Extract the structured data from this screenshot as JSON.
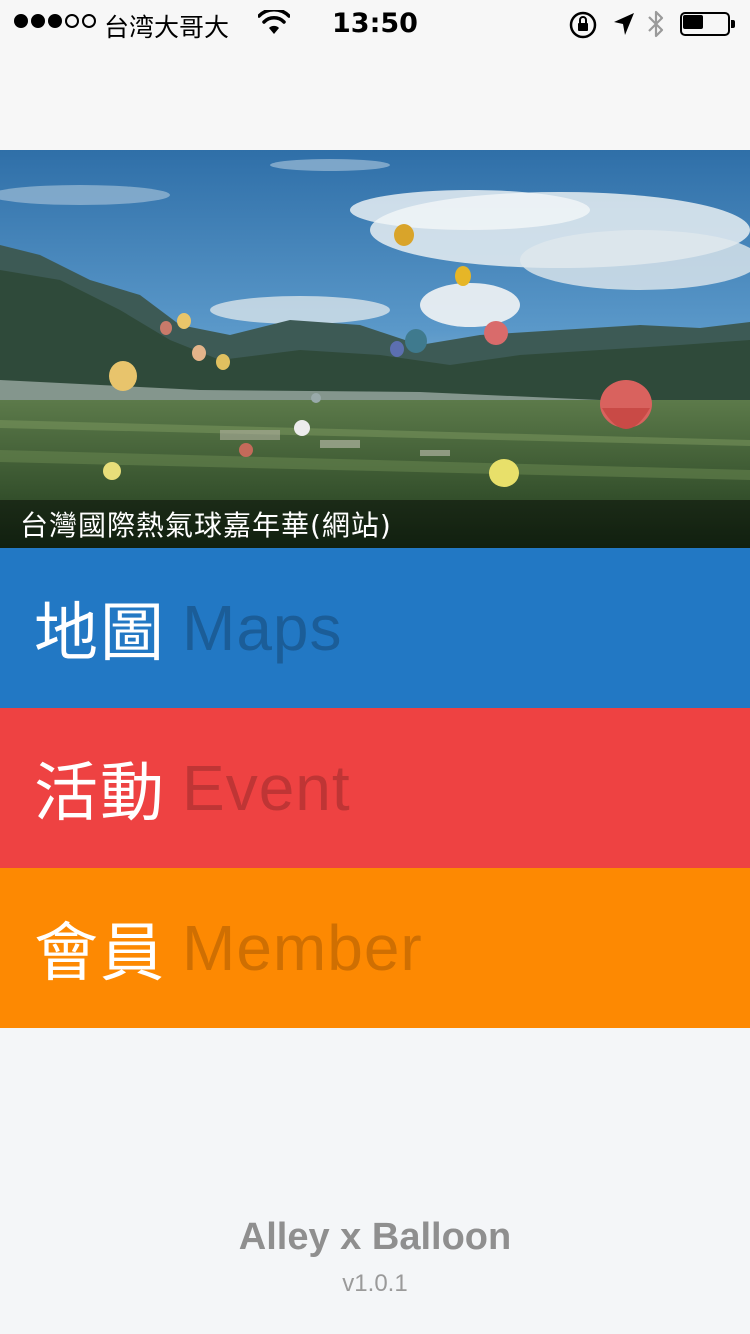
{
  "status_bar": {
    "signal_filled": 3,
    "signal_total": 5,
    "carrier": "台湾大哥大",
    "time": "13:50",
    "battery_level": 0.45
  },
  "hero": {
    "caption": "台灣國際熱氣球嘉年華(網站)"
  },
  "menu": {
    "maps": {
      "zh": "地圖",
      "en": "Maps",
      "color": "#2278c4"
    },
    "event": {
      "zh": "活動",
      "en": "Event",
      "color": "#ee4242"
    },
    "member": {
      "zh": "會員",
      "en": "Member",
      "color": "#fd8902"
    }
  },
  "footer": {
    "brand": "Alley x Balloon",
    "version": "v1.0.1"
  }
}
